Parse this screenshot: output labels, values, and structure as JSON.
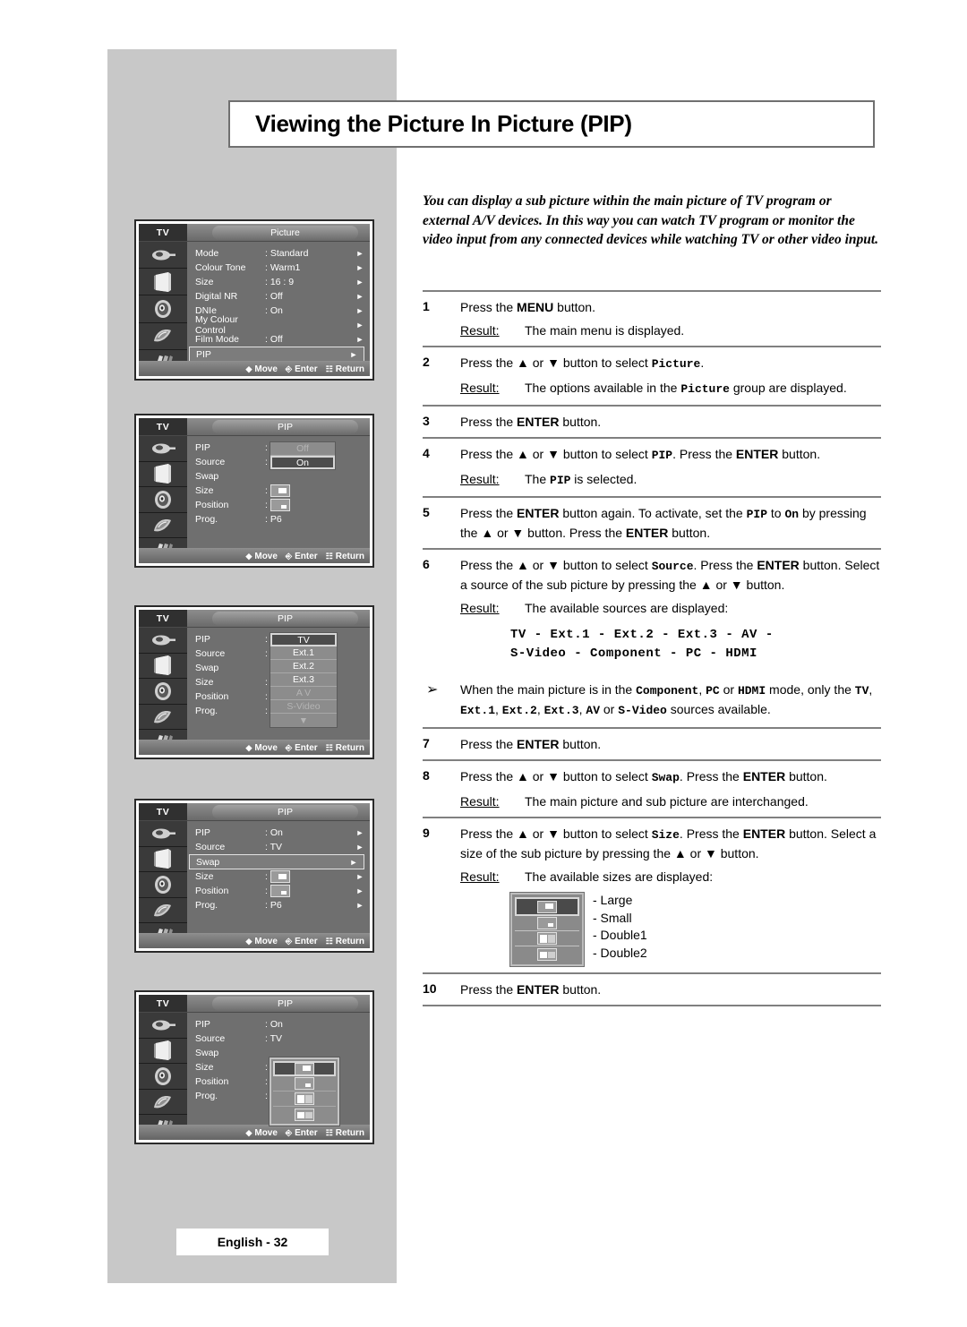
{
  "page": {
    "title": "Viewing the Picture In Picture (PIP)",
    "intro": "You can display a sub picture within the main picture of TV program or external A/V devices. In this way you can watch TV program or monitor the video input from any connected devices while watching TV or other video input.",
    "footer": "English - 32"
  },
  "steps": [
    {
      "num": "1",
      "text_before": "Press the ",
      "bold1": "MENU",
      "text_after": " button.",
      "result_label": "Result:",
      "result": "The main menu is displayed."
    },
    {
      "num": "2",
      "result_label": "Result:",
      "result_pre": "The options available in the ",
      "result_mono": "Picture",
      "result_post": " group are displayed."
    },
    {
      "num": "3",
      "text": "Press the ENTER button."
    },
    {
      "num": "4",
      "result_label": "Result:",
      "result_pre": "The ",
      "result_mono": "PIP",
      "result_post": " is selected."
    },
    {
      "num": "5"
    },
    {
      "num": "6",
      "result_label": "Result:",
      "result": "The available sources are displayed:",
      "source_line1": "TV - Ext.1 - Ext.2 - Ext.3 - AV -",
      "source_line2": "S-Video - Component - PC - HDMI"
    },
    {
      "num": "7",
      "text": "Press the ENTER button."
    },
    {
      "num": "8",
      "result_label": "Result:",
      "result": "The main picture and sub picture are interchanged."
    },
    {
      "num": "9",
      "result_label": "Result:",
      "result": "The available sizes are displayed:"
    },
    {
      "num": "10",
      "text": "Press the ENTER button."
    }
  ],
  "note": {
    "bullet": "➢",
    "text": "When the main picture is in the Component, PC or HDMI mode, only the TV, Ext.1, Ext.2, Ext.3, AV or S-Video sources available."
  },
  "size_options": [
    {
      "label": "- Large",
      "glyph": "large"
    },
    {
      "label": "- Small",
      "glyph": "small"
    },
    {
      "label": "- Double1",
      "glyph": "double1"
    },
    {
      "label": "- Double2",
      "glyph": "double2"
    }
  ],
  "osd_common": {
    "tv_label": "TV",
    "footer": {
      "move": "Move",
      "enter": "Enter",
      "return": "Return"
    },
    "icons": [
      "input-plug-icon",
      "picture-tv-icon",
      "sound-speaker-icon",
      "feature-icon",
      "setup-icon"
    ]
  },
  "osd_menus": [
    {
      "tab": "Picture",
      "rows": [
        {
          "label": "Mode",
          "sep": ":",
          "value": "Standard",
          "arrow": true
        },
        {
          "label": "Colour Tone",
          "sep": ":",
          "value": "Warm1",
          "arrow": true
        },
        {
          "label": "Size",
          "sep": ":",
          "value": "16 : 9",
          "arrow": true
        },
        {
          "label": "Digital NR",
          "sep": ":",
          "value": "Off",
          "arrow": true
        },
        {
          "label": "DNIe",
          "sep": ":",
          "value": "On",
          "arrow": true
        },
        {
          "label": "My Colour Control",
          "sep": "",
          "value": "",
          "arrow": true
        },
        {
          "label": "Film Mode",
          "sep": ":",
          "value": "Off",
          "arrow": true
        },
        {
          "label": "PIP",
          "sep": "",
          "value": "",
          "arrow": true,
          "highlight": true
        }
      ]
    },
    {
      "tab": "PIP",
      "rows": [
        {
          "label": "PIP",
          "sep": ":",
          "value": ""
        },
        {
          "label": "Source",
          "sep": ":",
          "value": ""
        },
        {
          "label": "Swap",
          "sep": "",
          "value": ""
        },
        {
          "label": "Size",
          "sep": ":",
          "value": "",
          "glyph": "large"
        },
        {
          "label": "Position",
          "sep": ":",
          "value": "",
          "glyph": "small"
        },
        {
          "label": "Prog.",
          "sep": ":",
          "value": "P6"
        }
      ],
      "popup": {
        "kind": "onoff",
        "items": [
          {
            "label": "Off",
            "state": "dim"
          },
          {
            "label": "On",
            "state": "sel"
          }
        ]
      }
    },
    {
      "tab": "PIP",
      "rows": [
        {
          "label": "PIP",
          "sep": ":",
          "value": ""
        },
        {
          "label": "Source",
          "sep": ":",
          "value": ""
        },
        {
          "label": "Swap",
          "sep": "",
          "value": ""
        },
        {
          "label": "Size",
          "sep": ":",
          "value": ""
        },
        {
          "label": "Position",
          "sep": ":",
          "value": ""
        },
        {
          "label": "Prog.",
          "sep": ":",
          "value": ""
        }
      ],
      "popup": {
        "kind": "sources",
        "items": [
          {
            "label": "TV",
            "state": "sel"
          },
          {
            "label": "Ext.1",
            "state": ""
          },
          {
            "label": "Ext.2",
            "state": ""
          },
          {
            "label": "Ext.3",
            "state": ""
          },
          {
            "label": "A V",
            "state": "dim"
          },
          {
            "label": "S-Video",
            "state": "dim"
          },
          {
            "label": "▼",
            "state": "dim"
          }
        ]
      }
    },
    {
      "tab": "PIP",
      "rows": [
        {
          "label": "PIP",
          "sep": ":",
          "value": "On",
          "arrow": true
        },
        {
          "label": "Source",
          "sep": ":",
          "value": "TV",
          "arrow": true
        },
        {
          "label": "Swap",
          "sep": "",
          "value": "",
          "arrow": true,
          "highlight": true
        },
        {
          "label": "Size",
          "sep": ":",
          "value": "",
          "arrow": true,
          "glyph": "large"
        },
        {
          "label": "Position",
          "sep": ":",
          "value": "",
          "arrow": true,
          "glyph": "small"
        },
        {
          "label": "Prog.",
          "sep": ":",
          "value": "P6",
          "arrow": true
        }
      ]
    },
    {
      "tab": "PIP",
      "rows": [
        {
          "label": "PIP",
          "sep": ":",
          "value": "On"
        },
        {
          "label": "Source",
          "sep": ":",
          "value": "TV"
        },
        {
          "label": "Swap",
          "sep": "",
          "value": ""
        },
        {
          "label": "Size",
          "sep": ":",
          "value": ""
        },
        {
          "label": "Position",
          "sep": ":",
          "value": ""
        },
        {
          "label": "Prog.",
          "sep": ":",
          "value": ""
        }
      ],
      "popup": {
        "kind": "sizes",
        "items": [
          {
            "glyph": "large",
            "state": "sel"
          },
          {
            "glyph": "small",
            "state": ""
          },
          {
            "glyph": "double1",
            "state": ""
          },
          {
            "glyph": "double2",
            "state": ""
          }
        ]
      }
    }
  ]
}
